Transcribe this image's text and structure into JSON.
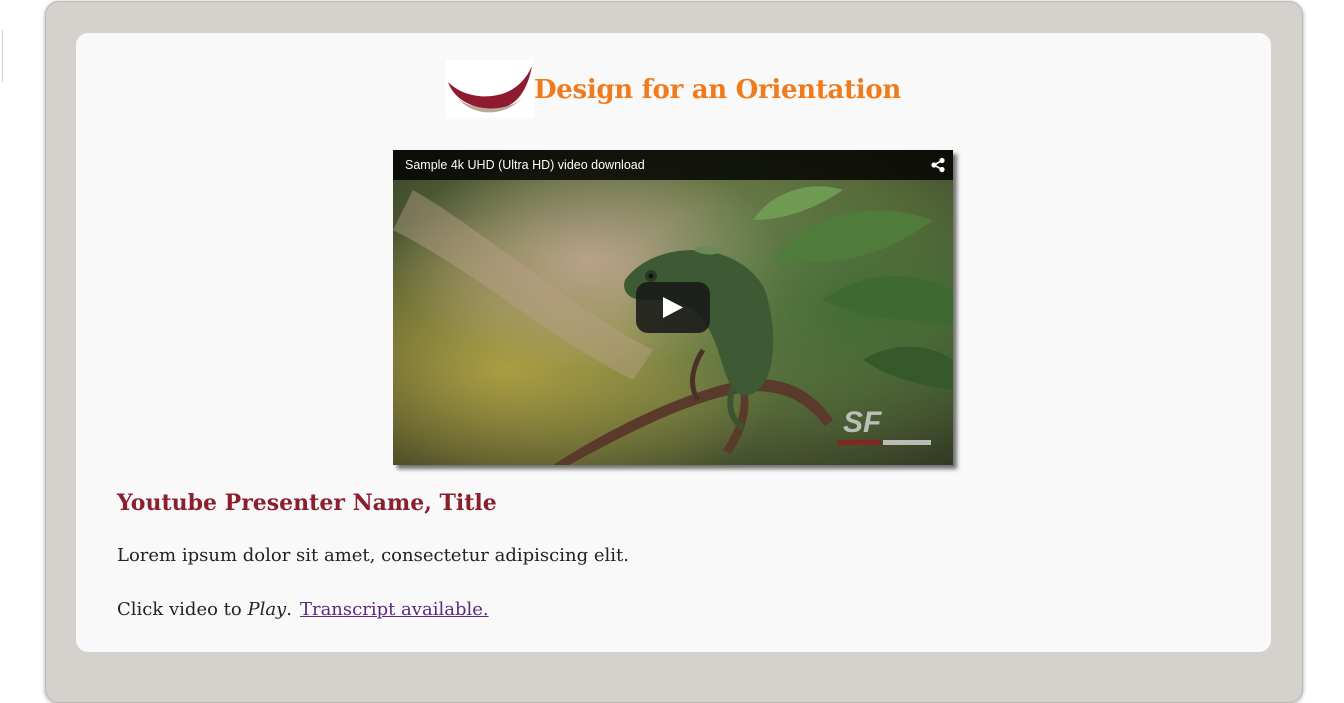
{
  "header": {
    "title": "Design for an Orientation",
    "logo_icon": "swoosh-logo-icon",
    "title_color": "#f07b1d"
  },
  "video": {
    "title": "Sample 4k UHD (Ultra HD) video download",
    "share_icon": "share-icon",
    "play_icon": "play-icon",
    "watermark_icon": "stock-footage-watermark-icon"
  },
  "content": {
    "presenter": "Youtube Presenter Name, Title",
    "presenter_color": "#8b1f2e",
    "description": "Lorem ipsum dolor sit amet, consectetur adipiscing elit.",
    "instruction_prefix": "Click video to ",
    "instruction_action": "Play",
    "instruction_suffix": ".",
    "transcript_link": "Transcript available."
  },
  "colors": {
    "frame": "#d5d1cc",
    "card": "#f9f9f9",
    "link": "#5a2a82"
  }
}
